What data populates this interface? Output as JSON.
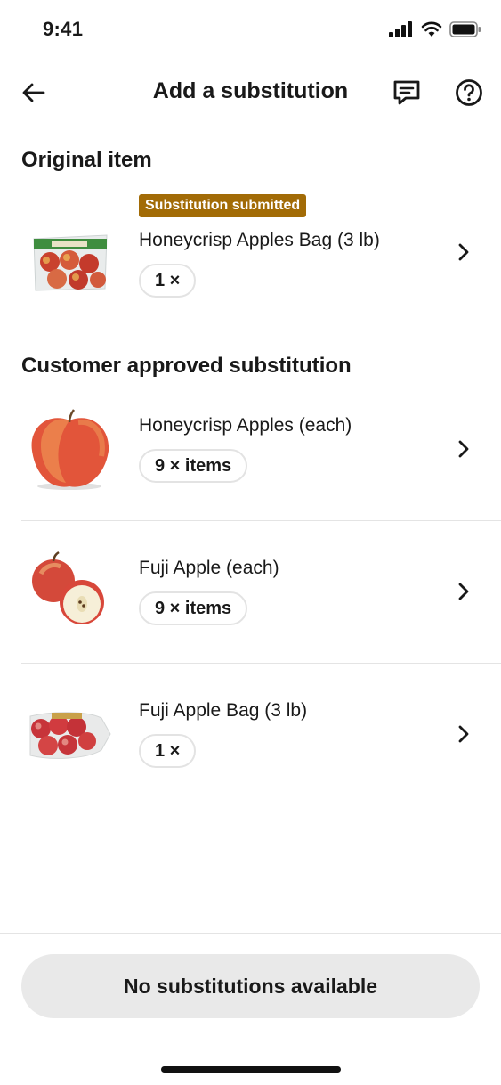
{
  "status_bar": {
    "time": "9:41"
  },
  "nav": {
    "title": "Add a substitution",
    "icons": {
      "back": "arrow-left-icon",
      "chat": "chat-icon",
      "help": "help-icon"
    }
  },
  "original_section": {
    "heading": "Original item",
    "item": {
      "badge": "Substitution submitted",
      "badge_color": "#a26b06",
      "name": "Honeycrisp Apples Bag (3 lb)",
      "quantity": "1 ×"
    }
  },
  "substitution_section": {
    "heading": "Customer approved substitution",
    "items": [
      {
        "name": "Honeycrisp Apples (each)",
        "quantity": "9 × items"
      },
      {
        "name": "Fuji Apple (each)",
        "quantity": "9 × items"
      },
      {
        "name": "Fuji Apple Bag (3 lb)",
        "quantity": "1 ×"
      }
    ]
  },
  "footer": {
    "button_label": "No substitutions available"
  }
}
